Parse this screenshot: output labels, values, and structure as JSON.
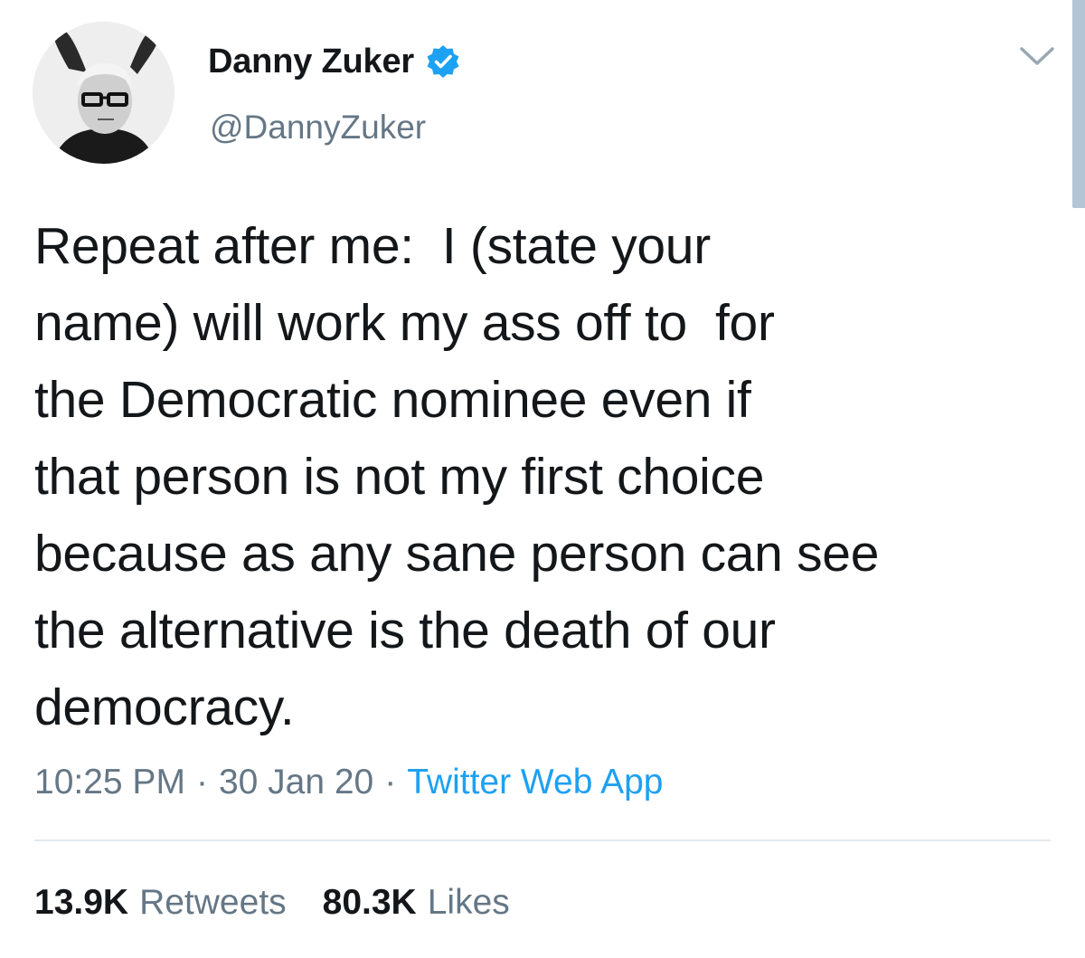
{
  "user": {
    "display_name": "Danny Zuker",
    "handle": "@DannyZuker",
    "verified_icon": "verified-badge-icon",
    "avatar": "avatar-photo"
  },
  "tweet": {
    "lines": [
      "Repeat after me:  I (state your",
      "name) will work my ass off to  for",
      "the Democratic nominee even if",
      "that person is not my first choice",
      "because as any sane person can see",
      "the alternative is the death of our",
      "democracy."
    ]
  },
  "meta": {
    "time": "10:25 PM",
    "separator": "·",
    "date": "30 Jan 20",
    "source": "Twitter Web App"
  },
  "stats": {
    "retweets_count": "13.9K",
    "retweets_label": "Retweets",
    "likes_count": "80.3K",
    "likes_label": "Likes"
  },
  "colors": {
    "text": "#14171a",
    "secondary": "#657786",
    "accent": "#1da1f2",
    "divider": "#e1e8ed"
  },
  "icons": {
    "menu": "chevron-down-icon",
    "verified": "verified-badge-icon"
  }
}
